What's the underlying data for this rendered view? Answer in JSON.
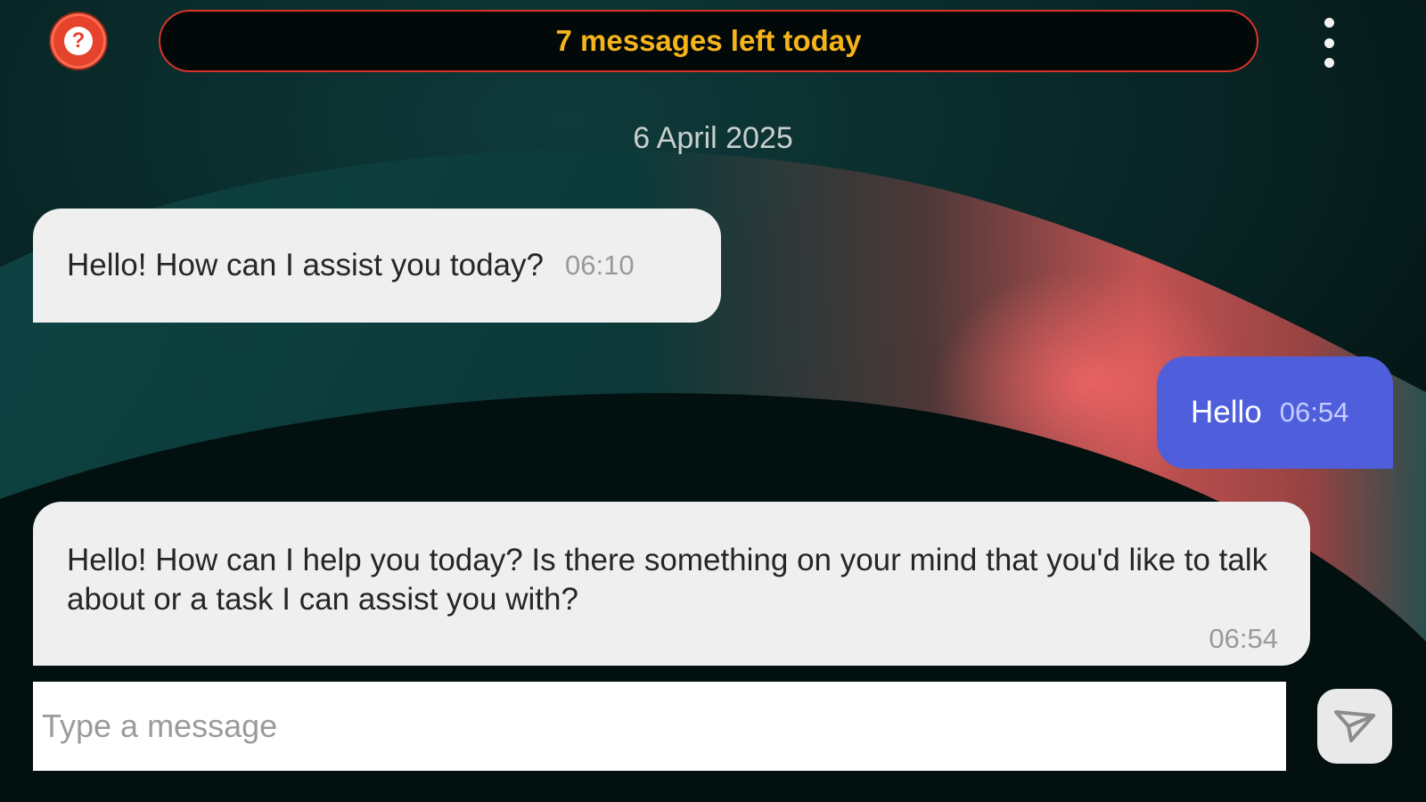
{
  "header": {
    "help_icon": "question-mark-icon",
    "help_glyph": "?",
    "quota_text": "7 messages left today",
    "menu_icon": "more-vertical-icon"
  },
  "chat": {
    "date": "6 April 2025",
    "messages": [
      {
        "sender": "bot",
        "text": "Hello! How can I assist you today?",
        "time": "06:10"
      },
      {
        "sender": "user",
        "text": "Hello",
        "time": "06:54"
      },
      {
        "sender": "bot",
        "text": "Hello! How can I help you today? Is there something on your mind that you'd like to talk about or a task I can assist you with?",
        "time": "06:54"
      }
    ]
  },
  "composer": {
    "placeholder": "Type a message",
    "value": "",
    "send_icon": "send-icon"
  },
  "colors": {
    "quota_text": "#f4b41a",
    "quota_border": "#d8342b",
    "help_button": "#e5432c",
    "user_bubble": "#4f5fdb",
    "bot_bubble": "#efefef"
  }
}
